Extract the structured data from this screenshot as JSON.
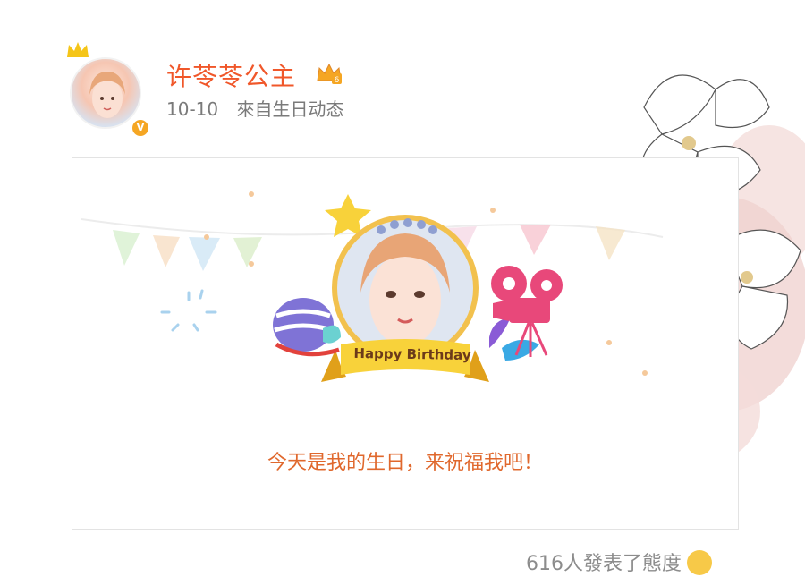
{
  "post": {
    "username": "许苓苓公主",
    "date": "10-10",
    "source": "來自生日动态",
    "member_badge_icon": "crown-level-badge-icon",
    "verified_icon": "verified-v-icon"
  },
  "card": {
    "banner_text": "Happy Birthday",
    "wish_text": "今天是我的生日，来祝福我吧！"
  },
  "footer": {
    "reaction_text": "616人發表了態度",
    "emoji_icon": "grinning-face-icon"
  },
  "colors": {
    "username": "#f0572a",
    "wish": "#e0682d",
    "meta": "#7a7a7a"
  }
}
